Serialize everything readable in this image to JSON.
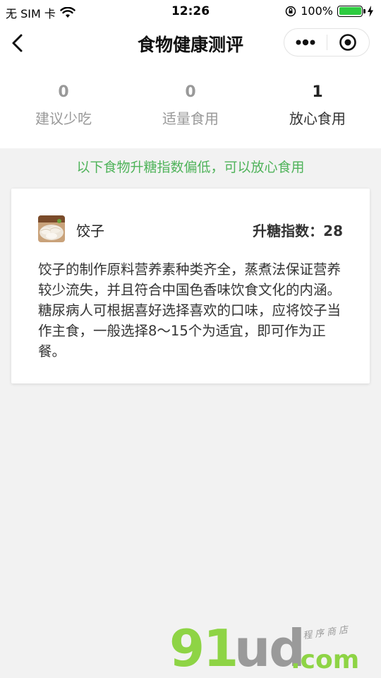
{
  "status_bar": {
    "carrier": "无 SIM 卡",
    "time": "12:26",
    "battery_percent": "100%",
    "battery_level": 1.0,
    "icons": [
      "wifi-icon",
      "orientation-lock-icon",
      "battery-icon",
      "charging-icon"
    ]
  },
  "nav": {
    "title": "食物健康测评",
    "back_icon": "chevron-left-icon",
    "more_icon": "more-dots-icon",
    "close_icon": "target-circle-icon"
  },
  "stats": [
    {
      "count": "0",
      "label": "建议少吃",
      "active": false
    },
    {
      "count": "0",
      "label": "适量食用",
      "active": false
    },
    {
      "count": "1",
      "label": "放心食用",
      "active": true
    }
  ],
  "notice": "以下食物升糖指数偏低，可以放心食用",
  "food_card": {
    "name": "饺子",
    "gi_label": "升糖指数：",
    "gi_value": "28",
    "description": "饺子的制作原料营养素种类齐全，蒸煮法保证营养较少流失，并且符合中国色香味饮食文化的内涵。糖尿病人可根据喜好选择喜欢的口味，应将饺子当作主食，一般选择8～15个为适宜，即可作为正餐。"
  },
  "watermark": {
    "brand": "91ud",
    "tld": ".com",
    "tagline": "小程序商店"
  },
  "colors": {
    "accent_green": "#4fb35a",
    "page_bg": "#f2f2f2",
    "inactive_text": "#999999"
  }
}
